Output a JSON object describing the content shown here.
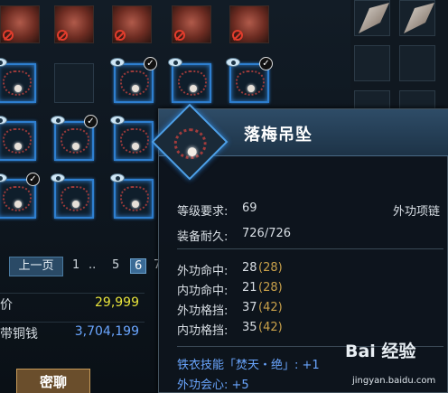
{
  "pagination": {
    "prev_label": "上一页",
    "pages": [
      "1",
      "..",
      "5",
      "6",
      "7"
    ],
    "current": "6"
  },
  "prices": [
    {
      "label": "价",
      "value": "29,999",
      "color": "#e8e33a"
    },
    {
      "label": "带铜钱",
      "value": "3,704,199",
      "color": "#6aa6ff"
    }
  ],
  "bottom_button": "密聊",
  "tooltip": {
    "title": "落梅吊坠",
    "level_req_label": "等级要求:",
    "level_req_value": "69",
    "type_label": "外功项链",
    "durability_label": "装备耐久:",
    "durability_value": "726/726",
    "stats": [
      {
        "label": "外功命中:",
        "value": "28",
        "paren": "(28)"
      },
      {
        "label": "内功命中:",
        "value": "21",
        "paren": "(28)"
      },
      {
        "label": "外功格挡:",
        "value": "37",
        "paren": "(42)"
      },
      {
        "label": "内功格挡:",
        "value": "35",
        "paren": "(42)"
      }
    ],
    "skill_line": "铁衣技能「焚天・绝」: +1",
    "crit_line": "外功会心: +5"
  },
  "watermark": {
    "logo": "Bai 经验",
    "url": "jingyan.baidu.com"
  },
  "partial": {
    "ghost_price": "29,999"
  },
  "icons": [
    "chest-armor-icon",
    "ban-icon",
    "eye-icon",
    "check-icon",
    "necklace-icon",
    "wing-icon"
  ]
}
